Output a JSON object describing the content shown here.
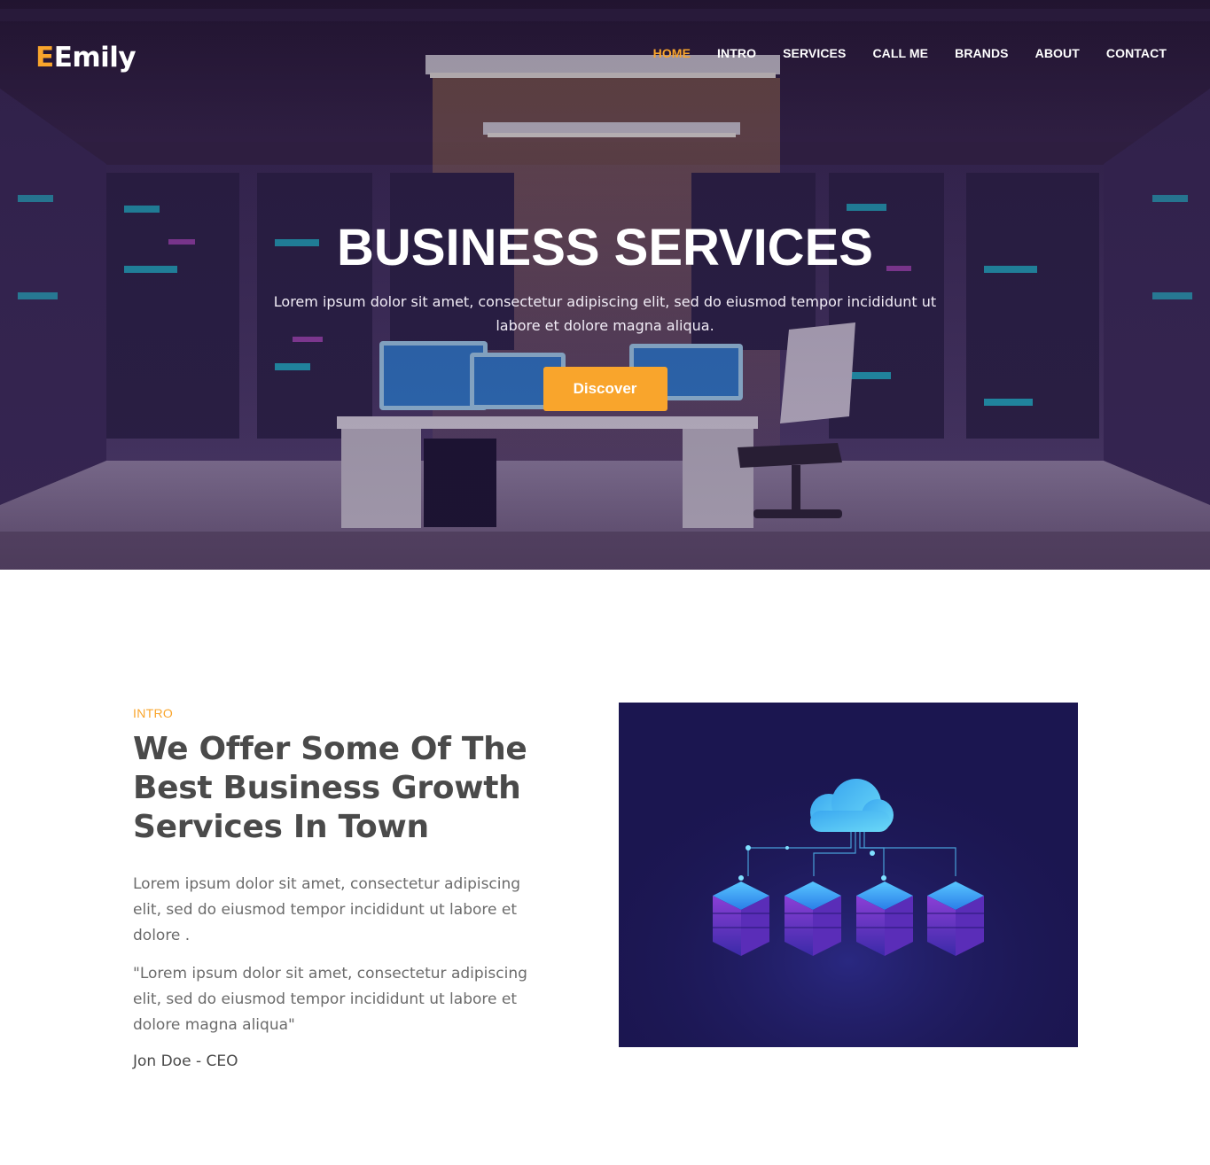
{
  "header": {
    "logo_mark": "E",
    "logo_text": "Emily",
    "nav": [
      "HOME",
      "INTRO",
      "SERVICES",
      "CALL ME",
      "BRANDS",
      "ABOUT",
      "CONTACT"
    ],
    "active_nav": "HOME"
  },
  "hero": {
    "title": "BUSINESS SERVICES",
    "text_line1": "Lorem ipsum dolor sit amet, consectetur adipiscing elit, sed do eiusmod tempor incididunt ut",
    "text_line2": "labore et dolore magna aliqua.",
    "button_label": "Discover",
    "image_icon": "server-room-illustration"
  },
  "intro": {
    "tag": "INTRO",
    "title": "We Offer Some Of The Best Business Growth Services In Town",
    "paragraph": "Lorem ipsum dolor sit amet, consectetur adipiscing elit, sed do eiusmod tempor incididunt ut labore et dolore .",
    "quote": "\"Lorem ipsum dolor sit amet, consectetur adipiscing elit, sed do eiusmod tempor incididunt ut labore et dolore magna aliqua\"",
    "author": "Jon Doe - CEO",
    "image_icon": "cloud-servers-illustration"
  },
  "colors": {
    "accent": "#f9a52c",
    "hero_bg": "#2a1d3e",
    "intro_image_bg": "#1b1650",
    "heading": "#4a4a4a",
    "body_text": "#6b6b6b"
  }
}
